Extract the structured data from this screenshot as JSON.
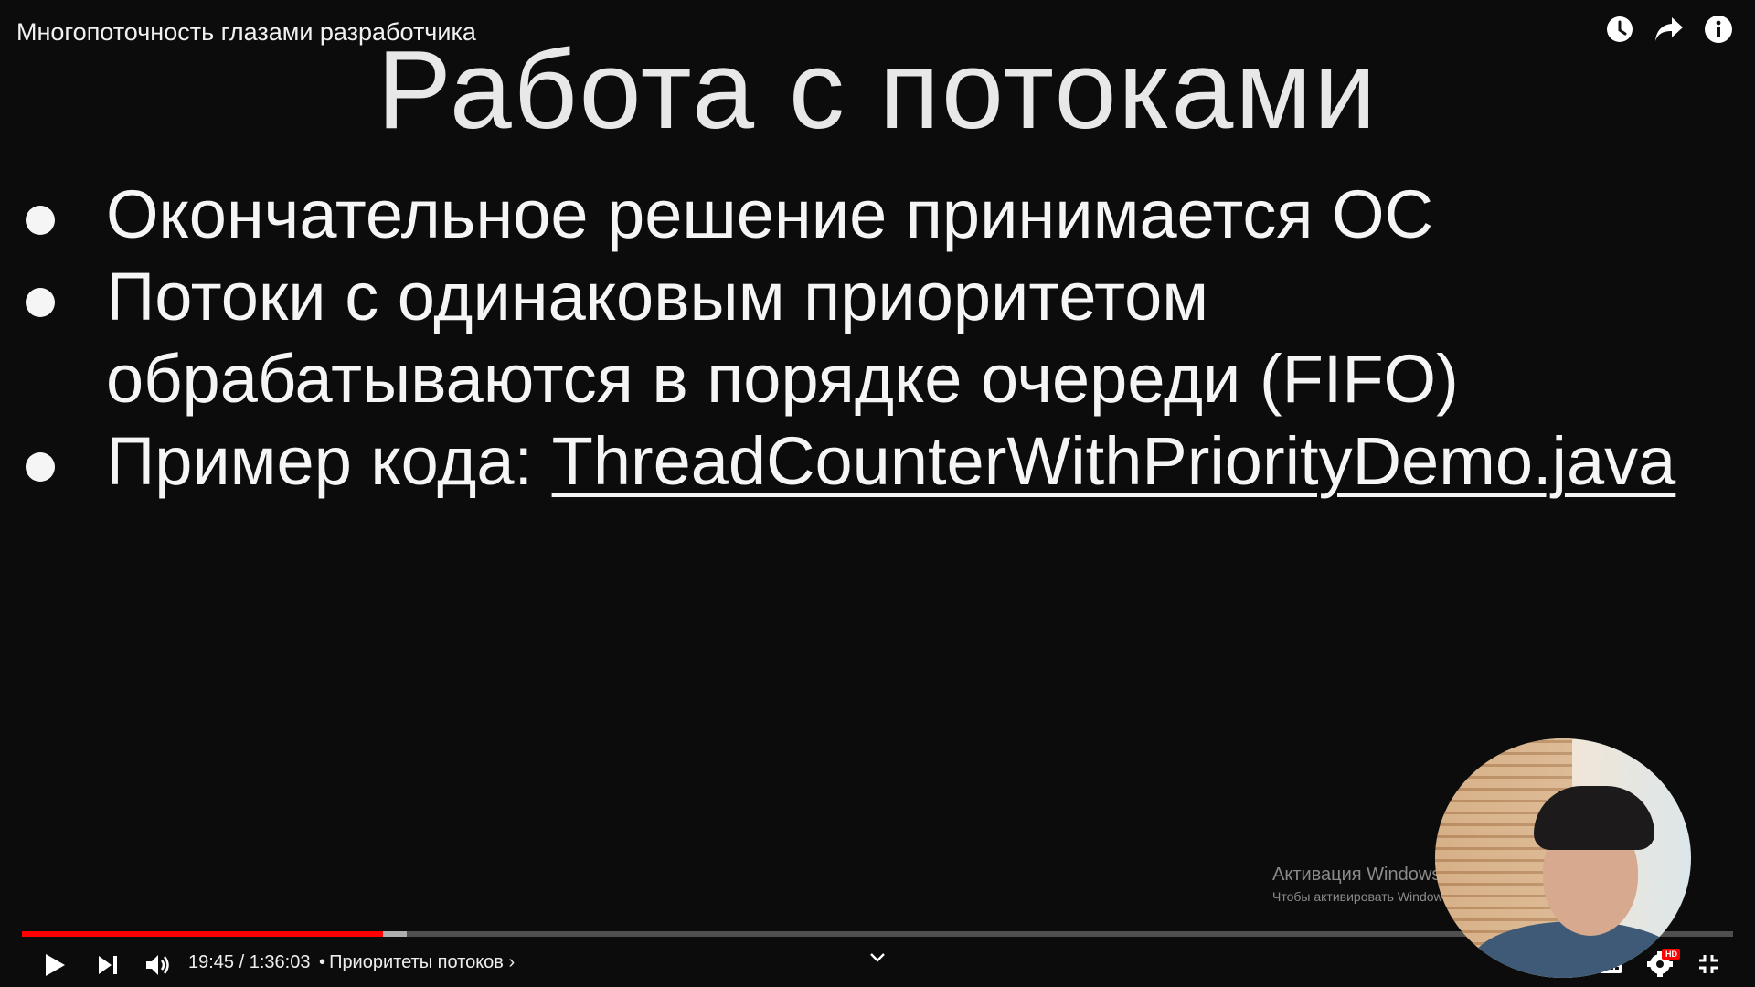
{
  "player": {
    "video_title": "Многопоточность глазами разработчика",
    "time_current": "19:45",
    "time_separator": "/",
    "time_total": "1:36:03",
    "chapter_separator": "•",
    "chapter": "Приоритеты потоков",
    "chapter_chevron": "›",
    "progress_fraction": 0.211,
    "colors": {
      "progress_played": "#ff0000",
      "background": "#0c0c0c"
    },
    "icons": {
      "top": [
        "watch-later-icon",
        "share-icon",
        "info-icon"
      ],
      "bottom_left": [
        "play-icon",
        "next-icon",
        "volume-icon"
      ],
      "bottom_right": [
        "autoplay-toggle-icon",
        "subtitles-icon",
        "settings-icon",
        "exit-fullscreen-icon"
      ],
      "settings_badge": "HD"
    }
  },
  "slide": {
    "title": "Работа с потоками",
    "bullets": [
      {
        "text": "Окончательное решение принимается ОС"
      },
      {
        "text": "Потоки с одинаковым приоритетом обрабатываются в порядке очереди (FIFO)"
      },
      {
        "prefix": "Пример кода: ",
        "link": "ThreadCounterWithPriorityDemo.java"
      }
    ]
  },
  "watermark": {
    "title": "Активация Windows",
    "subtitle": "Чтобы активировать Windows, перейдите в раздел \"Параметры\"."
  }
}
